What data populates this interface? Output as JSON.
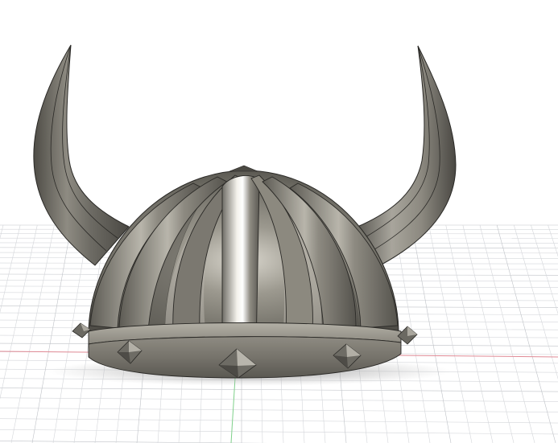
{
  "viewport": {
    "background": "#ffffff",
    "grid_color": "#d4d6da",
    "grid_major_color": "#bfc2c7",
    "x_axis_color": "#e08a95",
    "y_axis_color": "#7fd08a"
  },
  "model": {
    "body_color": "#7d7a72",
    "body_light": "#c9c6bd",
    "body_dark": "#4b4943",
    "edge_color": "#2a2926",
    "shadow_color": "#9a9a9a"
  }
}
